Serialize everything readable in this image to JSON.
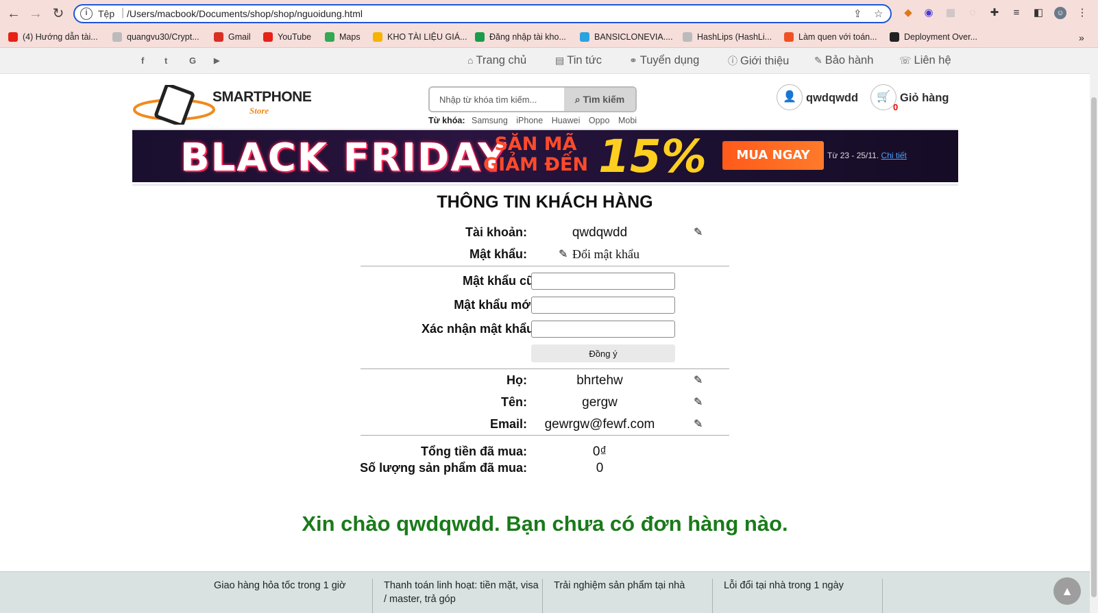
{
  "browser": {
    "address_scheme": "Tệp",
    "url": "/Users/macbook/Documents/shop/shop/nguoidung.html",
    "bookmarks": [
      {
        "label": "(4) Hướng dẫn tài...",
        "icon": "youtube-icon",
        "color": "#e62117"
      },
      {
        "label": "quangvu30/Crypt...",
        "icon": "github-icon",
        "color": "#bbbbbb"
      },
      {
        "label": "Gmail",
        "icon": "gmail-icon",
        "color": "#d93025"
      },
      {
        "label": "YouTube",
        "icon": "youtube-icon",
        "color": "#e62117"
      },
      {
        "label": "Maps",
        "icon": "maps-icon",
        "color": "#34a853"
      },
      {
        "label": "KHO TÀI LIỆU GIÁ...",
        "icon": "drive-icon",
        "color": "#f4b400"
      },
      {
        "label": "Đăng nhập tài kho...",
        "icon": "green-logo-icon",
        "color": "#1a9c4c"
      },
      {
        "label": "BANSICLONEVIA....",
        "icon": "triangle-logo-icon",
        "color": "#2aa3e0"
      },
      {
        "label": "HashLips (HashLi...",
        "icon": "github-icon",
        "color": "#bbbbbb"
      },
      {
        "label": "Làm quen với toán...",
        "icon": "f8-icon",
        "color": "#f05123"
      },
      {
        "label": "Deployment Over...",
        "icon": "deploy-icon",
        "color": "#222222"
      }
    ]
  },
  "topbar": {
    "social": [
      "f",
      "t",
      "G",
      "▶"
    ],
    "nav": [
      {
        "icon": "home-icon",
        "glyph": "⌂",
        "label": "Trang chủ"
      },
      {
        "icon": "newspaper-icon",
        "glyph": "▤",
        "label": "Tin tức"
      },
      {
        "icon": "handshake-icon",
        "glyph": "⚭",
        "label": "Tuyển dụng"
      },
      {
        "icon": "info-icon",
        "glyph": "ⓘ",
        "label": "Giới thiệu"
      },
      {
        "icon": "wrench-icon",
        "glyph": "✎",
        "label": "Bảo hành"
      },
      {
        "icon": "phone-icon",
        "glyph": "☏",
        "label": "Liên hệ"
      }
    ]
  },
  "header": {
    "logo_text1": "SMARTPHONE",
    "logo_text2": "Store",
    "search_placeholder": "Nhập từ khóa tìm kiếm...",
    "search_button": "Tìm kiếm",
    "keywords_label": "Từ khóa:",
    "keywords": [
      "Samsung",
      "iPhone",
      "Huawei",
      "Oppo",
      "Mobi"
    ],
    "username": "qwdqwdd",
    "cart_label": "Giỏ hàng",
    "cart_count": "0"
  },
  "banner": {
    "title": "BLACK FRIDAY",
    "promo_line1": "SĂN MÃ",
    "promo_line2": "GIẢM ĐẾN",
    "percent": "15%",
    "button": "MUA NGAY",
    "date": "Từ 23 - 25/11.",
    "detail_link": "Chi tiết"
  },
  "profile": {
    "title": "THÔNG TIN KHÁCH HÀNG",
    "account_label": "Tài khoản:",
    "account_value": "qwdqwdd",
    "password_label": "Mật khẩu:",
    "change_password": "Đổi mật khẩu",
    "old_pw_label": "Mật khẩu cũ:",
    "new_pw_label": "Mật khẩu mới:",
    "confirm_pw_label": "Xác nhận mật khẩu:",
    "agree_button": "Đồng ý",
    "lastname_label": "Họ:",
    "lastname_value": "bhrtehw",
    "firstname_label": "Tên:",
    "firstname_value": "gergw",
    "email_label": "Email:",
    "email_value": "gewrgw@fewf.com",
    "total_label": "Tổng tiền đã mua:",
    "total_value": "0₫",
    "count_label": "Số lượng sản phẩm đã mua:",
    "count_value": "0"
  },
  "greeting": "Xin chào qwdqwdd. Bạn chưa có đơn hàng nào.",
  "footer": [
    "Giao hàng hỏa tốc trong 1 giờ",
    "Thanh toán linh hoạt: tiền mặt, visa / master, trả góp",
    "Trải nghiệm sản phẩm tại nhà",
    "Lỗi đổi tại nhà trong 1 ngày"
  ]
}
